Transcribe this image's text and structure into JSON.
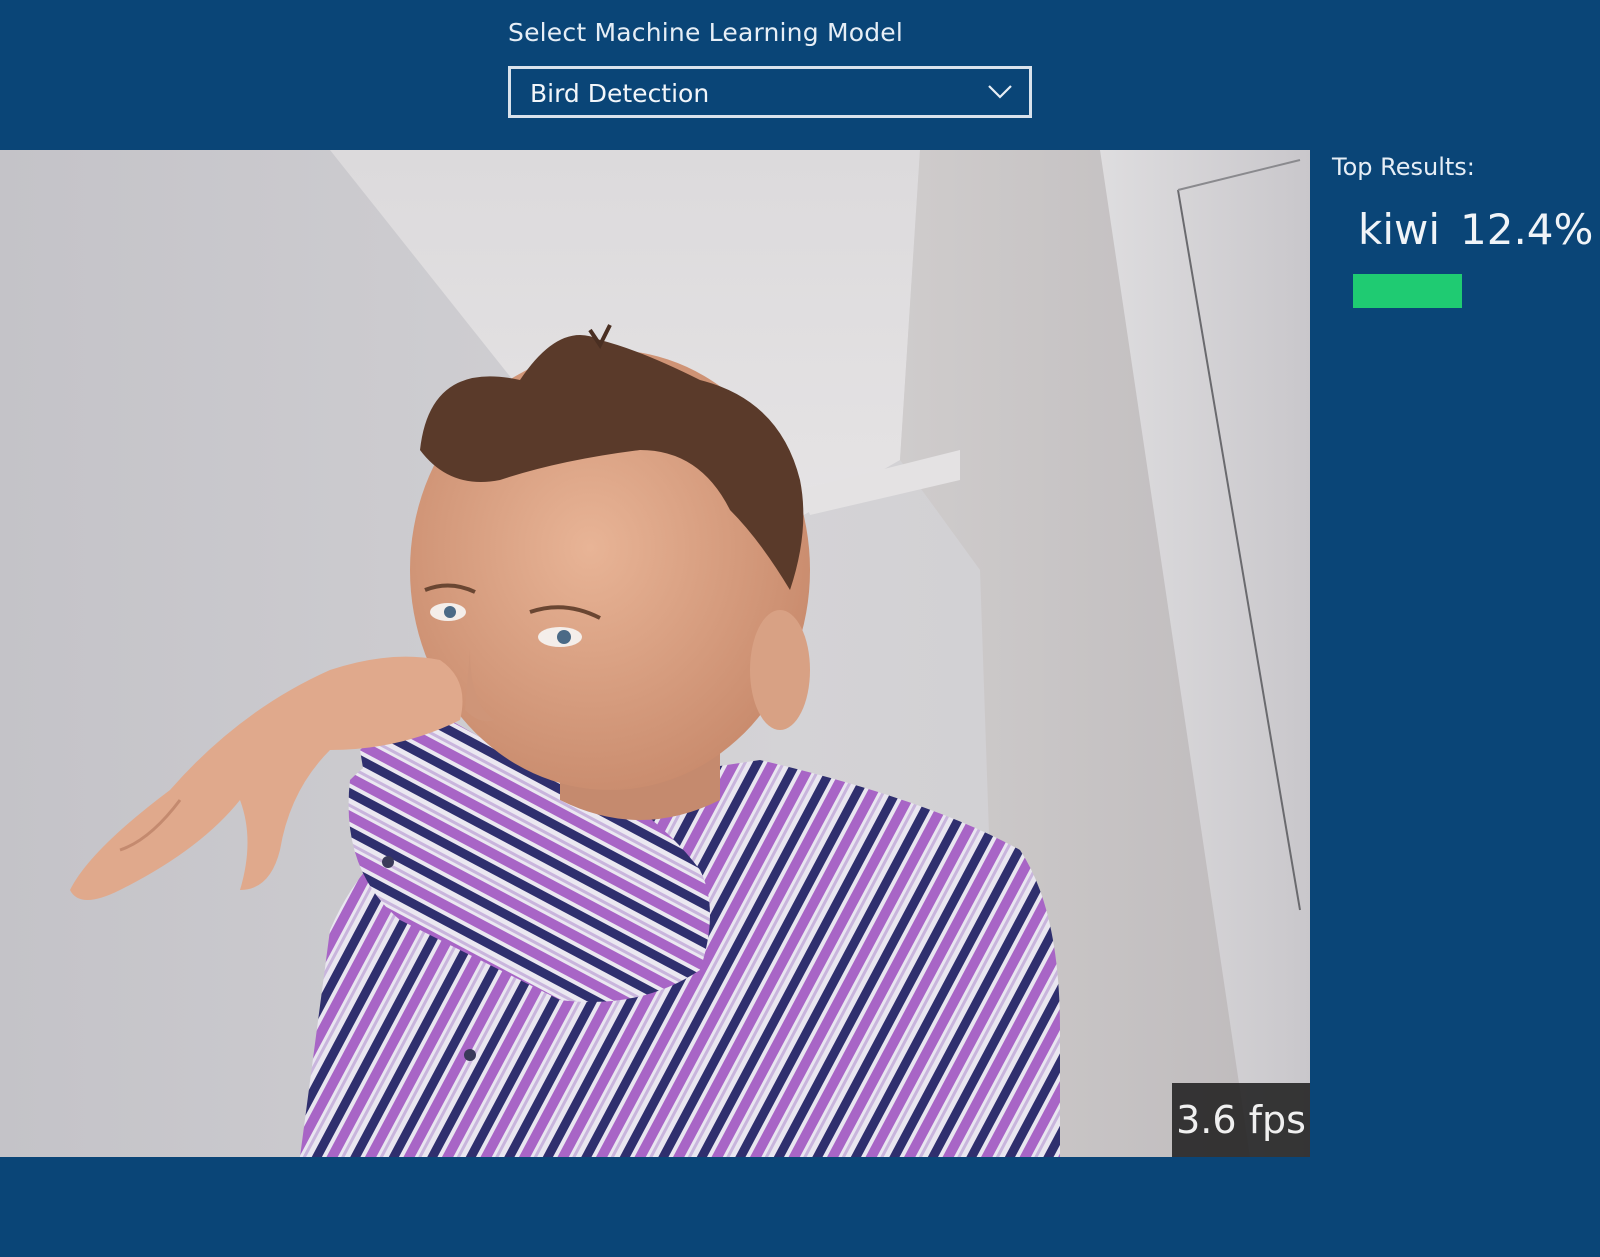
{
  "header": {
    "model_label": "Select Machine Learning Model",
    "selected_model": "Bird Detection",
    "chevron_icon": "chevron-down-icon"
  },
  "camera": {
    "fps_text": "3.6 fps"
  },
  "results": {
    "title": "Top Results:",
    "items": [
      {
        "label": "kiwi",
        "percent_text": "12.4%",
        "confidence": 0.124,
        "bar_color": "#1fcb72"
      }
    ]
  },
  "colors": {
    "background": "#0a4577",
    "accent": "#1fcb72"
  }
}
